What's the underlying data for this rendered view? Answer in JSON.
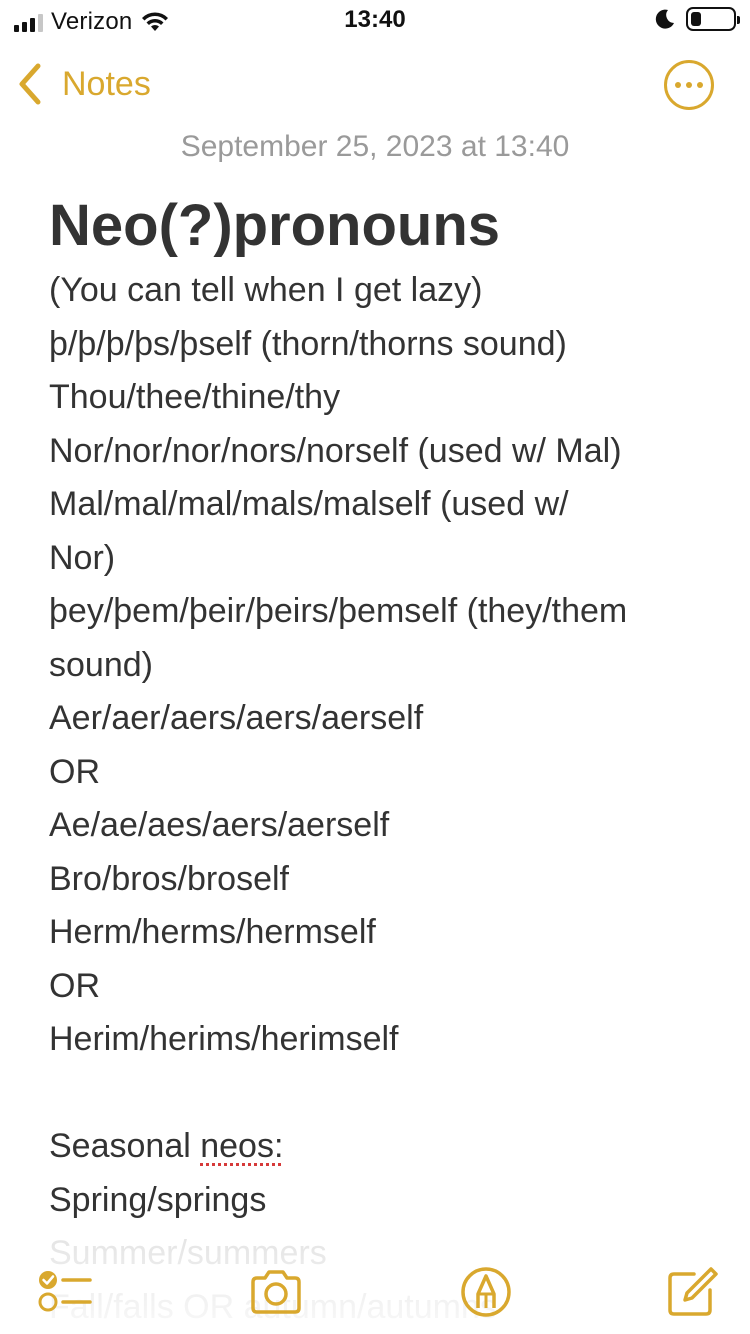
{
  "status_bar": {
    "carrier": "Verizon",
    "time": "13:40"
  },
  "nav": {
    "back_label": "Notes"
  },
  "note": {
    "date": "September 25, 2023 at 13:40",
    "title": "Neo(?)pronouns",
    "lines": [
      "(You can tell when I get lazy)",
      "þ/þ/þ/þs/þself (thorn/thorns sound)",
      "Thou/thee/thine/thy",
      "Nor/nor/nor/nors/norself (used w/ Mal)",
      "Mal/mal/mal/mals/malself (used w/",
      "Nor)",
      "þey/þem/þeir/þeirs/þemself (they/them",
      "sound)",
      "Aer/aer/aers/aers/aerself",
      "OR",
      "Ae/ae/aes/aers/aerself",
      "Bro/bros/broself",
      "Herm/herms/hermself",
      "OR",
      "Herim/herims/herimself"
    ],
    "seasonal_prefix": "Seasonal ",
    "seasonal_word": "neos:",
    "more_lines": [
      "Spring/springs",
      "Summer/summers",
      "Fall/falls OR autumn/autumns"
    ]
  },
  "colors": {
    "accent": "#d9a82e",
    "text": "#333333",
    "date": "#9a9a9a"
  },
  "icons": {
    "back": "chevron-left-icon",
    "more": "more-dots-icon",
    "checklist": "checklist-icon",
    "camera": "camera-icon",
    "markup": "markup-pen-icon",
    "compose": "compose-icon"
  }
}
